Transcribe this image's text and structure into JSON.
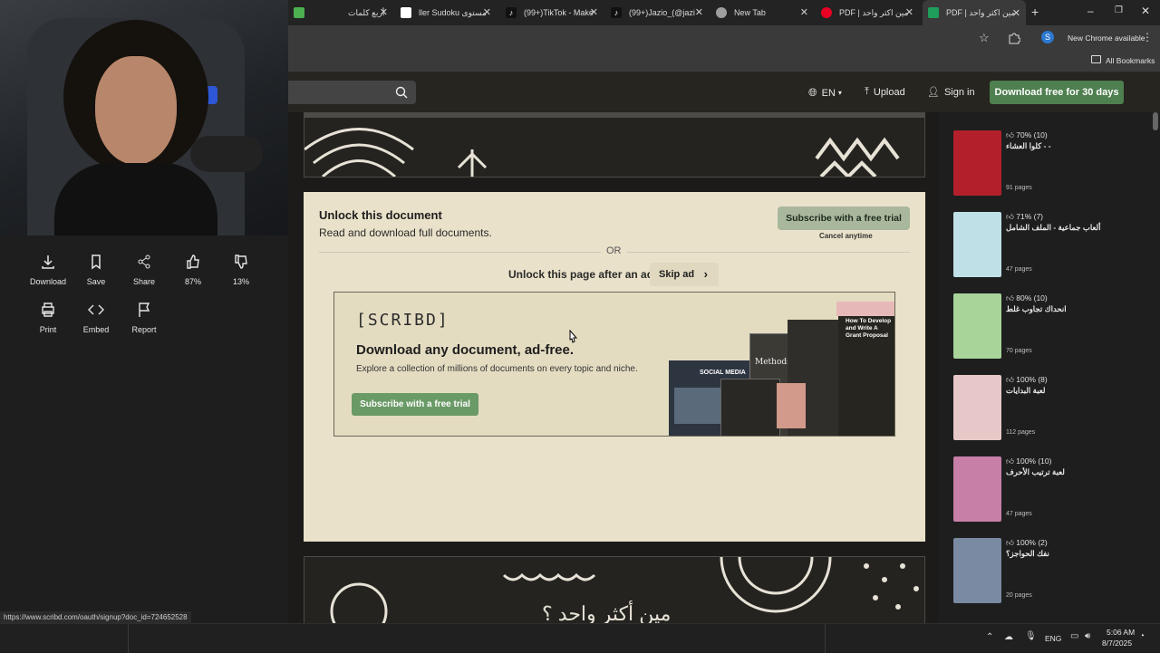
{
  "browser": {
    "tabs": [
      {
        "title": "أربع كلمات",
        "favicon_color": "#4caf50"
      },
      {
        "title": "ller Sudoku مستوى",
        "favicon_color": "#ffffff"
      },
      {
        "title": "(99+)TikTok - Make",
        "favicon_color": "#000000"
      },
      {
        "title": "(99+)Jazio_(@jazi",
        "favicon_color": "#000000"
      },
      {
        "title": "New Tab",
        "favicon_color": "#9e9e9e"
      },
      {
        "title": "PDF | مين اكثر واحد",
        "favicon_color": "#e60023"
      },
      {
        "title": "PDF | مين اكثر واحد",
        "favicon_color": "#1e9e5a"
      }
    ],
    "new_chrome": "New Chrome available",
    "profile_initial": "S",
    "all_bookmarks": "All Bookmarks"
  },
  "header": {
    "language": "EN",
    "upload": "Upload",
    "signin": "Sign in",
    "download_free": "Download free for 30 days"
  },
  "left_actions": [
    {
      "label": "Download",
      "icon": "download-icon"
    },
    {
      "label": "Save",
      "icon": "bookmark-icon"
    },
    {
      "label": "Share",
      "icon": "share-icon"
    },
    {
      "label": "87%",
      "icon": "thumbs-up-icon"
    },
    {
      "label": "13%",
      "icon": "thumbs-down-icon"
    },
    {
      "label": "Print",
      "icon": "print-icon"
    },
    {
      "label": "Embed",
      "icon": "embed-icon"
    },
    {
      "label": "Report",
      "icon": "flag-icon"
    }
  ],
  "unlock": {
    "title": "Unlock this document",
    "subtitle": "Read and download full documents.",
    "subscribe": "Subscribe with a free trial",
    "cancel": "Cancel anytime",
    "or": "OR",
    "unlock_page": "Unlock this page after an ad",
    "skip_ad": "Skip ad"
  },
  "ad": {
    "logo": "[SCRIBD]",
    "headline": "Download any document, ad-free.",
    "body": "Explore a collection of millions of documents on every topic and niche.",
    "button": "Subscribe with a free trial",
    "book1": "How To Develop and Write A Grant Proposal",
    "book2": "SOCIAL MEDIA",
    "book3": "Methods:"
  },
  "doc_bottom_title": "مين أكثر واحد ؟",
  "sidebar": [
    {
      "rating": "70% (10)",
      "title": "كلوا العشاء - -",
      "pages": "91 pages",
      "color": "#b3202c"
    },
    {
      "rating": "71% (7)",
      "title": "ألعاب جماعية - الملف الشامل",
      "pages": "47 pages",
      "color": "#bfe0e6"
    },
    {
      "rating": "80% (10)",
      "title": "انحداك تجاوب غلط",
      "pages": "70 pages",
      "color": "#a8d49a"
    },
    {
      "rating": "100% (8)",
      "title": "لعبة البدايات",
      "pages": "112 pages",
      "color": "#e7c7c7"
    },
    {
      "rating": "100% (10)",
      "title": "لعبة ترتيب الأحرف",
      "pages": "47 pages",
      "color": "#c77fa8"
    },
    {
      "rating": "100% (2)",
      "title": "نفك الحواجز؟",
      "pages": "20 pages",
      "color": "#7a8aa3"
    }
  ],
  "status_url": "https://www.scribd.com/oauth/signup?doc_id=724652528",
  "taskbar": {
    "lang": "ENG",
    "time": "5:06 AM",
    "date": "8/7/2025"
  }
}
